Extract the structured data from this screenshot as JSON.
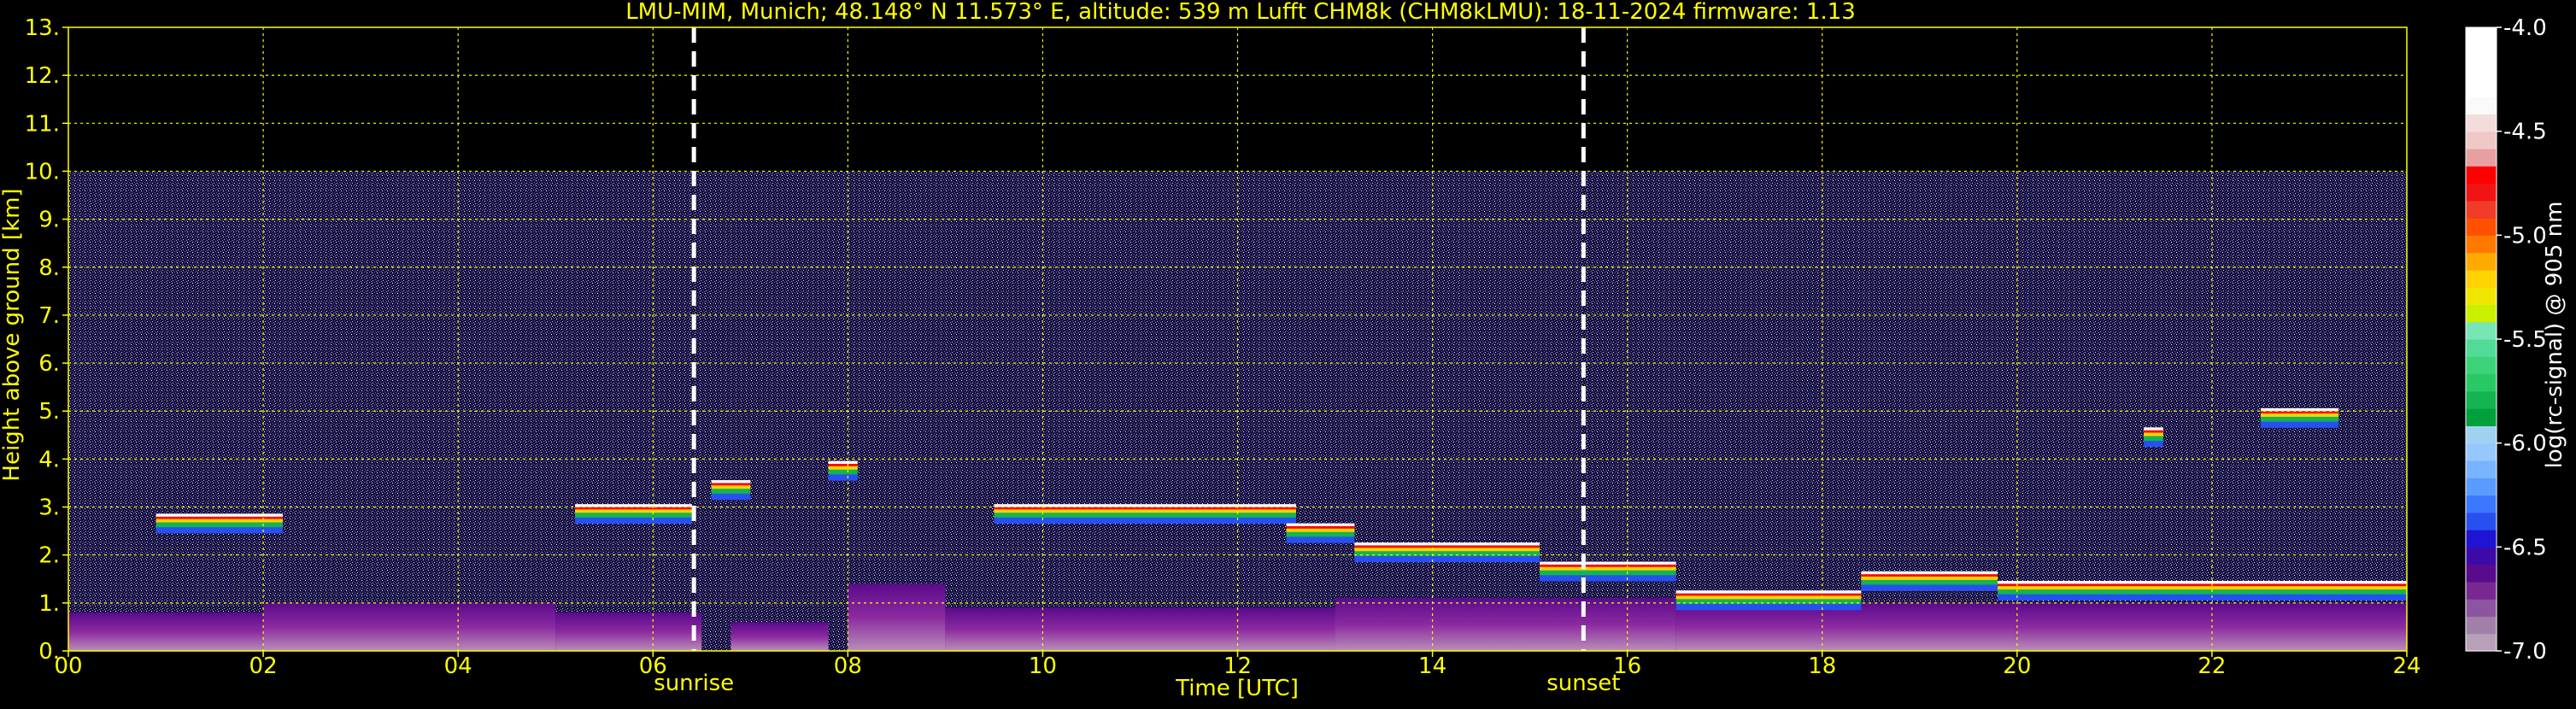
{
  "chart_data": {
    "type": "heatmap",
    "title": "LMU-MIM, Munich; 48.148° N 11.573° E, altitude: 539 m    Lufft CHM8k (CHM8kLMU): 18-11-2024    firmware: 1.13",
    "xlabel": "Time [UTC]",
    "ylabel": "Height above ground [km]",
    "xlim": [
      0,
      24
    ],
    "ylim": [
      0,
      13
    ],
    "x_ticks": [
      0,
      2,
      4,
      6,
      8,
      10,
      12,
      14,
      16,
      18,
      20,
      22,
      24
    ],
    "x_tick_labels": [
      "00",
      "02",
      "04",
      "06",
      "08",
      "10",
      "12",
      "14",
      "16",
      "18",
      "20",
      "22",
      "24"
    ],
    "y_ticks": [
      0,
      1,
      2,
      3,
      4,
      5,
      6,
      7,
      8,
      9,
      10,
      11,
      12,
      13
    ],
    "y_tick_labels": [
      "0.",
      "1.",
      "2.",
      "3.",
      "4.",
      "5.",
      "6.",
      "7.",
      "8.",
      "9.",
      "10.",
      "11.",
      "12.",
      "13."
    ],
    "grid": true,
    "data_top_km": 10,
    "markers": [
      {
        "label": "sunrise",
        "time_utc": 6.42
      },
      {
        "label": "sunset",
        "time_utc": 15.55
      }
    ],
    "cloud_layers": [
      {
        "start": 0.9,
        "end": 2.2,
        "height": 2.8
      },
      {
        "start": 5.2,
        "end": 6.4,
        "height": 3.0
      },
      {
        "start": 6.6,
        "end": 7.0,
        "height": 3.5
      },
      {
        "start": 7.8,
        "end": 8.1,
        "height": 3.9
      },
      {
        "start": 9.5,
        "end": 12.6,
        "height": 3.0
      },
      {
        "start": 12.5,
        "end": 13.2,
        "height": 2.6
      },
      {
        "start": 13.2,
        "end": 15.1,
        "height": 2.2
      },
      {
        "start": 15.1,
        "end": 16.5,
        "height": 1.8
      },
      {
        "start": 16.5,
        "end": 18.4,
        "height": 1.2
      },
      {
        "start": 18.4,
        "end": 19.8,
        "height": 1.6
      },
      {
        "start": 19.8,
        "end": 24.0,
        "height": 1.4
      },
      {
        "start": 21.3,
        "end": 21.5,
        "height": 4.6
      },
      {
        "start": 22.5,
        "end": 23.3,
        "height": 5.0
      }
    ],
    "boundary_layer": [
      {
        "start": 0.0,
        "end": 2.0,
        "height": 0.8
      },
      {
        "start": 2.0,
        "end": 5.0,
        "height": 1.0
      },
      {
        "start": 5.0,
        "end": 6.5,
        "height": 0.8
      },
      {
        "start": 6.8,
        "end": 7.8,
        "height": 0.6
      },
      {
        "start": 8.0,
        "end": 9.0,
        "height": 1.4
      },
      {
        "start": 9.0,
        "end": 13.0,
        "height": 0.9
      },
      {
        "start": 13.0,
        "end": 16.5,
        "height": 1.1
      },
      {
        "start": 16.5,
        "end": 24.0,
        "height": 1.0
      }
    ],
    "colorbar": {
      "label": "log(rc-signal) @ 905 nm",
      "range": [
        -7.0,
        -4.0
      ],
      "ticks": [
        -7.0,
        -6.5,
        -6.0,
        -5.5,
        -5.0,
        -4.5,
        -4.0
      ],
      "tick_labels": [
        "-7.0",
        "-6.5",
        "-6.0",
        "-5.5",
        "-5.0",
        "-4.5",
        "-4.0"
      ],
      "colors": [
        "#b8a0b8",
        "#a080a8",
        "#8c55a0",
        "#782890",
        "#5a0a8c",
        "#3c0aa8",
        "#1e14d2",
        "#2850f0",
        "#3c78ff",
        "#5a9bff",
        "#78b4ff",
        "#96c8ff",
        "#a0d2f0",
        "#00a03c",
        "#14b450",
        "#28c864",
        "#3cd278",
        "#50dc96",
        "#78e6b4",
        "#c8f000",
        "#f0e600",
        "#ffd200",
        "#ffaa00",
        "#ff7800",
        "#ff5000",
        "#f03c28",
        "#f01414",
        "#ff0000",
        "#e6a0a0",
        "#f0c8c8",
        "#f5dcdc",
        "#fafafa",
        "#ffffff",
        "#ffffff",
        "#ffffff",
        "#ffffff"
      ]
    },
    "colors": {
      "background": "#000000",
      "text": "#ffff00",
      "grid": "#ffff00",
      "colorbar_text": "#ffffff",
      "noise": "#5a4ab4"
    }
  }
}
